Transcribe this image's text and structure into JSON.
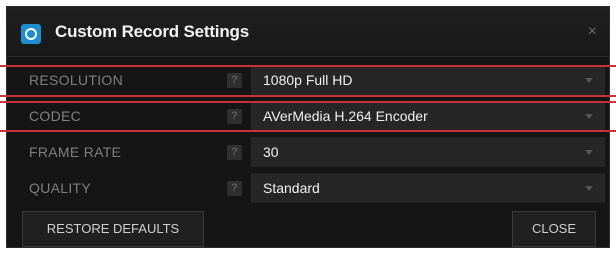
{
  "dialog": {
    "title": "Custom Record Settings",
    "close_glyph": "×",
    "app_icon": "record-icon"
  },
  "settings": [
    {
      "label": "RESOLUTION",
      "help": "?",
      "value": "1080p Full HD"
    },
    {
      "label": "CODEC",
      "help": "?",
      "value": "AVerMedia H.264 Encoder"
    },
    {
      "label": "FRAME RATE",
      "help": "?",
      "value": "30"
    },
    {
      "label": "QUALITY",
      "help": "?",
      "value": "Standard"
    }
  ],
  "buttons": {
    "restore": "RESTORE DEFAULTS",
    "close": "CLOSE"
  },
  "colors": {
    "highlight": "#c8323c",
    "accent": "#1d8fd0",
    "background": "#151515"
  }
}
